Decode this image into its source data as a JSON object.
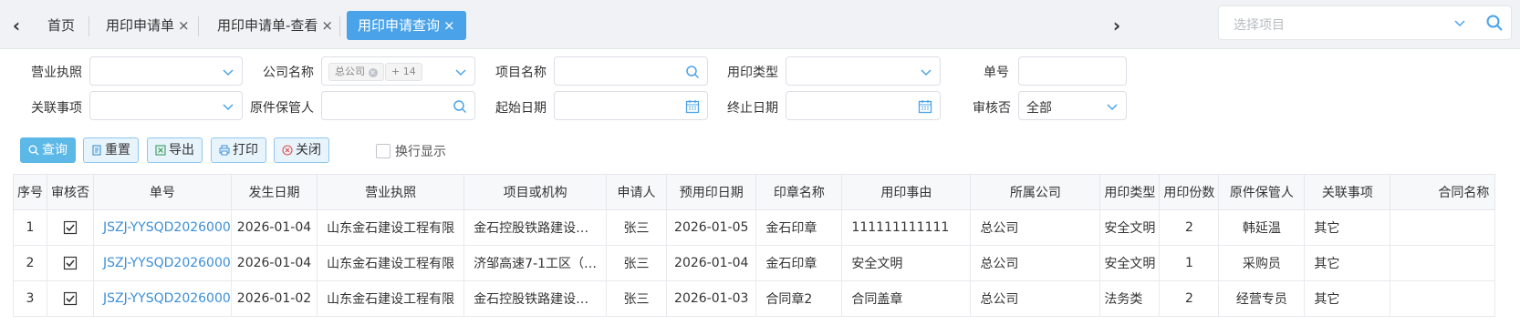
{
  "tabs": {
    "prev_arrow": "‹",
    "next_arrow": "›",
    "items": [
      {
        "label": "首页",
        "closable": false
      },
      {
        "label": "用印申请单",
        "closable": true
      },
      {
        "label": "用印申请单-查看",
        "closable": true
      },
      {
        "label": "用印申请查询",
        "closable": true,
        "active": true
      }
    ],
    "close_glyph": "×"
  },
  "project_select": {
    "placeholder": "选择项目"
  },
  "filters": {
    "business_license": {
      "label": "营业执照",
      "value": ""
    },
    "company_name": {
      "label": "公司名称",
      "tags": [
        "总公司",
        "+ 14"
      ]
    },
    "project_name": {
      "label": "项目名称",
      "value": ""
    },
    "seal_type": {
      "label": "用印类型",
      "value": ""
    },
    "order_no": {
      "label": "单号",
      "value": ""
    },
    "related_item": {
      "label": "关联事项",
      "value": ""
    },
    "original_keeper": {
      "label": "原件保管人",
      "value": ""
    },
    "start_date": {
      "label": "起始日期",
      "value": ""
    },
    "end_date": {
      "label": "终止日期",
      "value": ""
    },
    "reviewed": {
      "label": "审核否",
      "value": "全部"
    }
  },
  "toolbar": {
    "query": "查询",
    "reset": "重置",
    "export": "导出",
    "print": "打印",
    "close": "关闭",
    "wrap_display": "换行显示"
  },
  "table": {
    "columns": [
      "序号",
      "审核否",
      "单号",
      "发生日期",
      "营业执照",
      "项目或机构",
      "申请人",
      "预用印日期",
      "印章名称",
      "用印事由",
      "所属公司",
      "用印类型",
      "用印份数",
      "原件保管人",
      "关联事项",
      "合同名称"
    ],
    "rows": [
      {
        "seq": "1",
        "reviewed": true,
        "no": "JSZJ-YYSQD2026000",
        "date": "2026-01-04",
        "license": "山东金石建设工程有限",
        "project": "金石控股铁路建设…",
        "applicant": "张三",
        "pre_date": "2026-01-05",
        "seal": "金石印章",
        "reason": "111111111111",
        "company": "总公司",
        "seal_type": "安全文明",
        "copies": "2",
        "keeper": "韩延温",
        "related": "其它",
        "contract": ""
      },
      {
        "seal_type": "安全文明",
        "seq": "2",
        "reviewed": true,
        "no": "JSZJ-YYSQD2026000",
        "date": "2026-01-04",
        "license": "山东金石建设工程有限",
        "project": "济邹高速7-1工区（…",
        "applicant": "张三",
        "pre_date": "2026-01-04",
        "seal": "金石印章",
        "reason": "安全文明",
        "company": "总公司",
        "copies": "1",
        "keeper": "采购员",
        "related": "其它",
        "contract": ""
      },
      {
        "seq": "3",
        "reviewed": true,
        "no": "JSZJ-YYSQD2026000",
        "date": "2026-01-02",
        "license": "山东金石建设工程有限",
        "project": "金石控股铁路建设…",
        "applicant": "张三",
        "pre_date": "2026-01-03",
        "seal": "合同章2",
        "reason": "合同盖章",
        "company": "总公司",
        "seal_type": "法务类",
        "copies": "2",
        "keeper": "经营专员",
        "related": "其它",
        "contract": ""
      }
    ]
  },
  "colors": {
    "accent": "#4aa3e8",
    "link": "#3b8fd8",
    "button_bg": "#e8f4fc"
  }
}
